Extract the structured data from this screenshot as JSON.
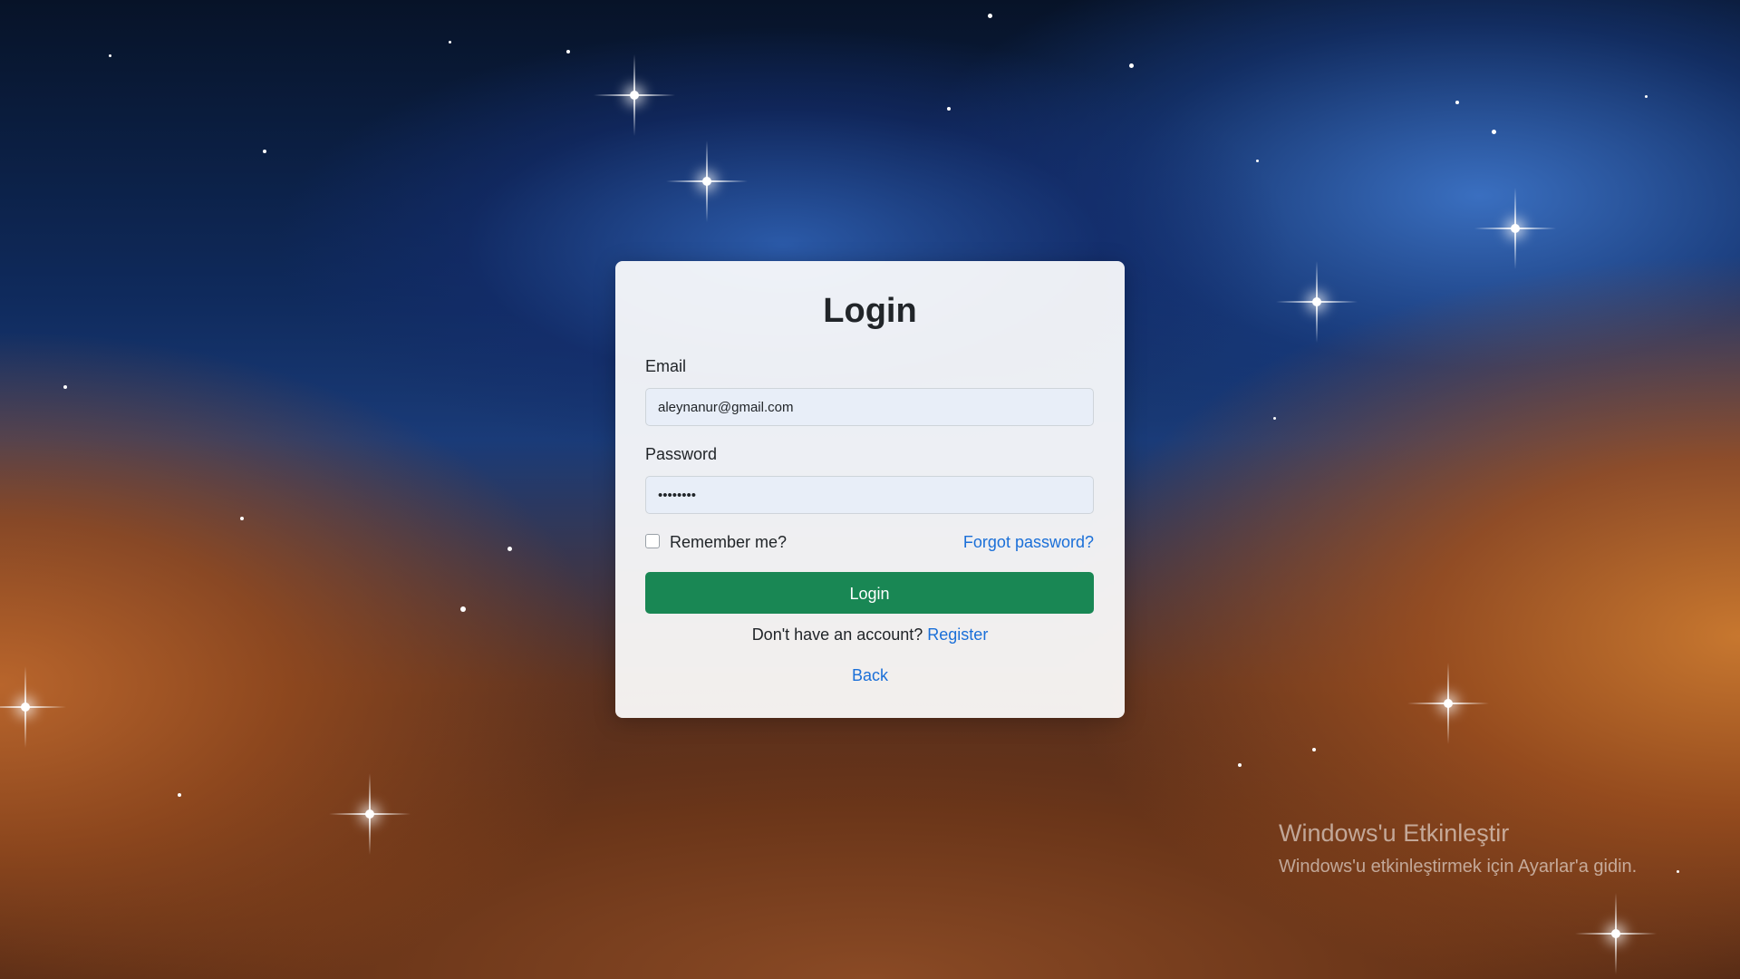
{
  "background": {
    "description_icon": "nebula-background"
  },
  "login_card": {
    "title": "Login",
    "email_label": "Email",
    "email_value": "aleynanur@gmail.com",
    "password_label": "Password",
    "password_value": "••••••••",
    "remember_label": "Remember me?",
    "remember_checked": false,
    "forgot_label": "Forgot password?",
    "submit_label": "Login",
    "register_prompt": "Don't have an account?",
    "register_link": "Register",
    "back_link": "Back"
  },
  "watermark": {
    "title": "Windows'u Etkinleştir",
    "subtitle": "Windows'u etkinleştirmek için Ayarlar'a gidin."
  },
  "colors": {
    "primary_button": "#198754",
    "link": "#1a6fd8"
  }
}
